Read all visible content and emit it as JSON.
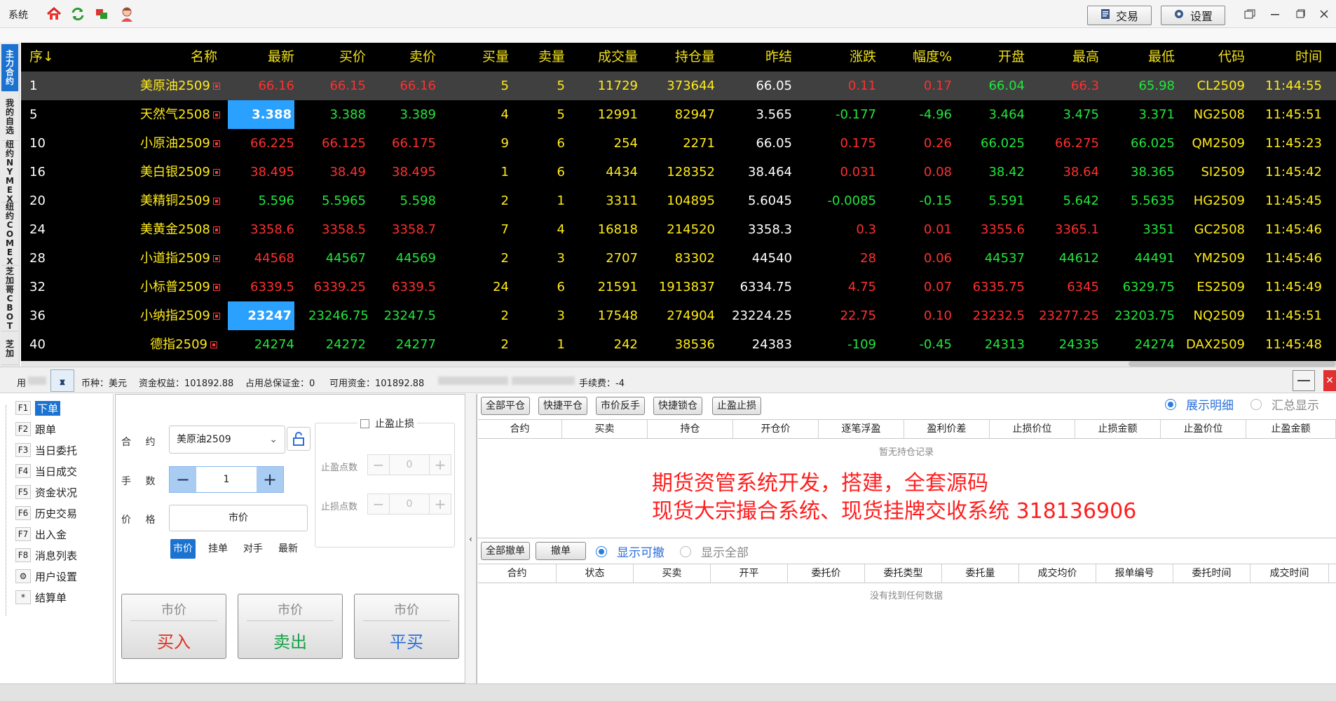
{
  "topbar": {
    "system_label": "系统",
    "trade_label": "交易",
    "settings_label": "设置"
  },
  "vtabs": [
    "主力合约",
    "我的自选",
    "纽约NYMEX",
    "纽约COMEX",
    "芝加哥CBOT",
    "芝加"
  ],
  "quote": {
    "headers": [
      "序↓",
      "名称",
      "最新",
      "买价",
      "卖价",
      "买量",
      "卖量",
      "成交量",
      "持仓量",
      "昨结",
      "涨跌",
      "幅度%",
      "开盘",
      "最高",
      "最低",
      "代码",
      "时间"
    ],
    "rows": [
      {
        "seq": "1",
        "name": "美原油2509",
        "last": "66.16",
        "bid": "66.15",
        "ask": "66.16",
        "bidvol": "5",
        "askvol": "5",
        "vol": "11729",
        "oi": "373644",
        "prev": "66.05",
        "chg": "0.11",
        "pct": "0.17",
        "open": "66.04",
        "high": "66.3",
        "low": "65.98",
        "code": "CL2509",
        "time": "11:44:55"
      },
      {
        "seq": "5",
        "name": "天然气2508",
        "last": "3.388",
        "bid": "3.388",
        "ask": "3.389",
        "bidvol": "4",
        "askvol": "5",
        "vol": "12991",
        "oi": "82947",
        "prev": "3.565",
        "chg": "-0.177",
        "pct": "-4.96",
        "open": "3.464",
        "high": "3.475",
        "low": "3.371",
        "code": "NG2508",
        "time": "11:45:51"
      },
      {
        "seq": "10",
        "name": "小原油2509",
        "last": "66.225",
        "bid": "66.125",
        "ask": "66.175",
        "bidvol": "9",
        "askvol": "6",
        "vol": "254",
        "oi": "2271",
        "prev": "66.05",
        "chg": "0.175",
        "pct": "0.26",
        "open": "66.025",
        "high": "66.275",
        "low": "66.025",
        "code": "QM2509",
        "time": "11:45:23"
      },
      {
        "seq": "16",
        "name": "美白银2509",
        "last": "38.495",
        "bid": "38.49",
        "ask": "38.495",
        "bidvol": "1",
        "askvol": "6",
        "vol": "4434",
        "oi": "128352",
        "prev": "38.464",
        "chg": "0.031",
        "pct": "0.08",
        "open": "38.42",
        "high": "38.64",
        "low": "38.365",
        "code": "SI2509",
        "time": "11:45:42"
      },
      {
        "seq": "20",
        "name": "美精铜2509",
        "last": "5.596",
        "bid": "5.5965",
        "ask": "5.598",
        "bidvol": "2",
        "askvol": "1",
        "vol": "3311",
        "oi": "104895",
        "prev": "5.6045",
        "chg": "-0.0085",
        "pct": "-0.15",
        "open": "5.591",
        "high": "5.642",
        "low": "5.5635",
        "code": "HG2509",
        "time": "11:45:45"
      },
      {
        "seq": "24",
        "name": "美黄金2508",
        "last": "3358.6",
        "bid": "3358.5",
        "ask": "3358.7",
        "bidvol": "7",
        "askvol": "4",
        "vol": "16818",
        "oi": "214520",
        "prev": "3358.3",
        "chg": "0.3",
        "pct": "0.01",
        "open": "3355.6",
        "high": "3365.1",
        "low": "3351",
        "code": "GC2508",
        "time": "11:45:46"
      },
      {
        "seq": "28",
        "name": "小道指2509",
        "last": "44568",
        "bid": "44567",
        "ask": "44569",
        "bidvol": "2",
        "askvol": "3",
        "vol": "2707",
        "oi": "83302",
        "prev": "44540",
        "chg": "28",
        "pct": "0.06",
        "open": "44537",
        "high": "44612",
        "low": "44491",
        "code": "YM2509",
        "time": "11:45:46"
      },
      {
        "seq": "32",
        "name": "小标普2509",
        "last": "6339.5",
        "bid": "6339.25",
        "ask": "6339.5",
        "bidvol": "24",
        "askvol": "6",
        "vol": "21591",
        "oi": "1913837",
        "prev": "6334.75",
        "chg": "4.75",
        "pct": "0.07",
        "open": "6335.75",
        "high": "6345",
        "low": "6329.75",
        "code": "ES2509",
        "time": "11:45:49"
      },
      {
        "seq": "36",
        "name": "小纳指2509",
        "last": "23247",
        "bid": "23246.75",
        "ask": "23247.5",
        "bidvol": "2",
        "askvol": "3",
        "vol": "17548",
        "oi": "274904",
        "prev": "23224.25",
        "chg": "22.75",
        "pct": "0.10",
        "open": "23232.5",
        "high": "23277.25",
        "low": "23203.75",
        "code": "NQ2509",
        "time": "11:45:51"
      },
      {
        "seq": "40",
        "name": "德指2509",
        "last": "24274",
        "bid": "24272",
        "ask": "24277",
        "bidvol": "2",
        "askvol": "1",
        "vol": "242",
        "oi": "38536",
        "prev": "24383",
        "chg": "-109",
        "pct": "-0.45",
        "open": "24313",
        "high": "24335",
        "low": "24274",
        "code": "DAX2509",
        "time": "11:45:48"
      }
    ]
  },
  "status": {
    "user_label": "用",
    "currency": "币种：美元",
    "equity": "资金权益：101892.88",
    "margin": "占用总保证金：0",
    "available": "可用资金：101892.88",
    "fee": "手续费：-4"
  },
  "menu": [
    {
      "key": "F1",
      "label": "下单"
    },
    {
      "key": "F2",
      "label": "跟单"
    },
    {
      "key": "F3",
      "label": "当日委托"
    },
    {
      "key": "F4",
      "label": "当日成交"
    },
    {
      "key": "F5",
      "label": "资金状况"
    },
    {
      "key": "F6",
      "label": "历史交易"
    },
    {
      "key": "F7",
      "label": "出入金"
    },
    {
      "key": "F8",
      "label": "消息列表"
    },
    {
      "key": "⚙",
      "label": "用户设置"
    },
    {
      "key": "*",
      "label": "结算单"
    }
  ],
  "order": {
    "contract_label": "合 约",
    "contract_value": "美原油2509",
    "qty_label": "手 数",
    "qty_value": "1",
    "price_label": "价 格",
    "price_value": "市价",
    "price_types": [
      "市价",
      "挂单",
      "对手",
      "最新"
    ],
    "tp_sl_label": "止盈止损",
    "tp_points_label": "止盈点数",
    "sl_points_label": "止损点数",
    "stepper_value": "0",
    "buttons": [
      {
        "top": "市价",
        "main": "买入",
        "color": "#e03020"
      },
      {
        "top": "市价",
        "main": "卖出",
        "color": "#18a048"
      },
      {
        "top": "市价",
        "main": "平买",
        "color": "#2a6fd8"
      }
    ]
  },
  "positions": {
    "buttons": [
      "全部平仓",
      "快捷平仓",
      "市价反手",
      "快捷锁仓",
      "止盈止损"
    ],
    "radio_detail": "展示明细",
    "radio_summary": "汇总显示",
    "columns": [
      "合约",
      "买卖",
      "持仓",
      "开仓价",
      "逐笔浮盈",
      "盈利价差",
      "止损价位",
      "止损金额",
      "止盈价位",
      "止盈金额"
    ],
    "empty_text": "暂无持仓记录"
  },
  "ad": {
    "line1": "期货资管系统开发，搭建，全套源码",
    "line2": "现货大宗撮合系统、现货挂牌交收系统  318136906"
  },
  "orders": {
    "buttons": [
      "全部撤单",
      "撤单"
    ],
    "radio_cancelable": "显示可撤",
    "radio_all": "显示全部",
    "columns": [
      "合约",
      "状态",
      "买卖",
      "开平",
      "委托价",
      "委托类型",
      "委托量",
      "成交均价",
      "报单编号",
      "委托时间",
      "成交时间"
    ],
    "empty_text": "没有找到任何数据"
  }
}
